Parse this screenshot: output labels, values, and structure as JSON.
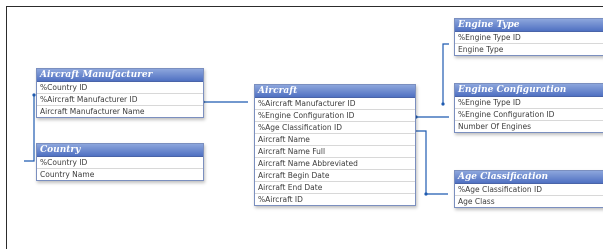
{
  "tables": {
    "aircraft_manufacturer": {
      "title": "Aircraft Manufacturer",
      "fields": [
        "%Country ID",
        "%Aircraft Manufacturer ID",
        "Aircraft Manufacturer Name"
      ]
    },
    "country": {
      "title": "Country",
      "fields": [
        "%Country ID",
        "Country Name"
      ]
    },
    "aircraft": {
      "title": "Aircraft",
      "fields": [
        "%Aircraft Manufacturer ID",
        "%Engine Configuration ID",
        "%Age Classification ID",
        "Aircraft Name",
        "Aircraft Name Full",
        "Aircraft Name Abbreviated",
        "Aircraft Begin Date",
        "Aircraft End Date",
        "%Aircraft ID"
      ]
    },
    "engine_type": {
      "title": "Engine Type",
      "fields": [
        "%Engine Type ID",
        "Engine Type"
      ]
    },
    "engine_configuration": {
      "title": "Engine Configuration",
      "fields": [
        "%Engine Type ID",
        "%Engine Configuration ID",
        "Number Of Engines"
      ]
    },
    "age_classification": {
      "title": "Age Classification",
      "fields": [
        "%Age Classification ID",
        "Age Class"
      ]
    }
  }
}
